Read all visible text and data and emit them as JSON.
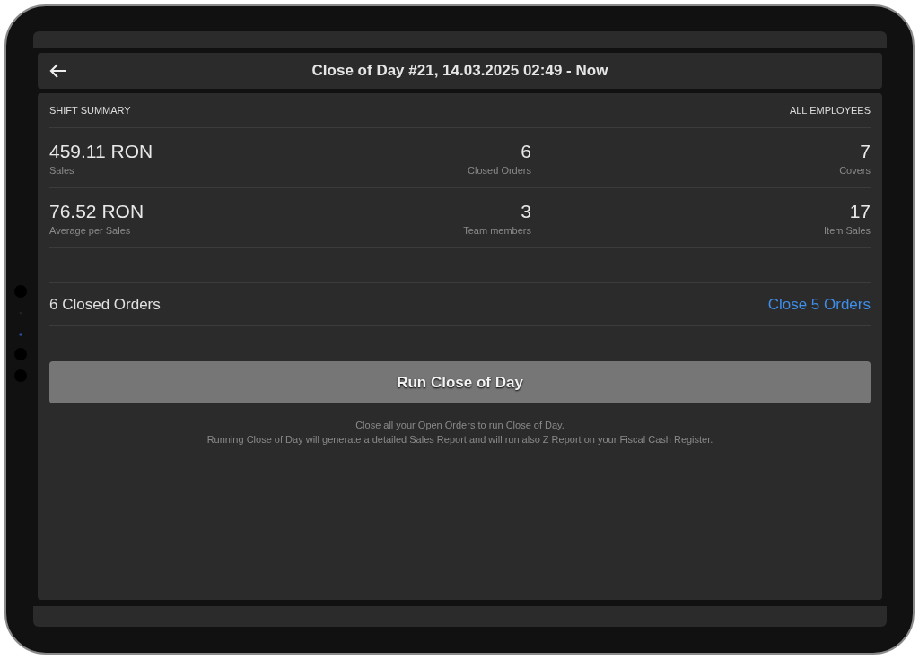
{
  "header": {
    "title": "Close of Day #21, 14.03.2025 02:49 - Now"
  },
  "summary": {
    "heading": "SHIFT SUMMARY",
    "filter": "ALL EMPLOYEES",
    "rows": [
      [
        {
          "value": "459.11 RON",
          "label": "Sales"
        },
        {
          "value": "6",
          "label": "Closed Orders"
        },
        {
          "value": "7",
          "label": "Covers"
        }
      ],
      [
        {
          "value": "76.52 RON",
          "label": "Average per Sales"
        },
        {
          "value": "3",
          "label": "Team members"
        },
        {
          "value": "17",
          "label": "Item Sales"
        }
      ]
    ]
  },
  "orders": {
    "label": "6 Closed Orders",
    "action": "Close 5 Orders"
  },
  "run_button": {
    "label": "Run Close of Day",
    "disabled": true
  },
  "notes": [
    "Close all your Open Orders to run Close of Day.",
    "Running Close of Day will generate a detailed Sales Report and will run also Z Report on your Fiscal Cash Register."
  ]
}
